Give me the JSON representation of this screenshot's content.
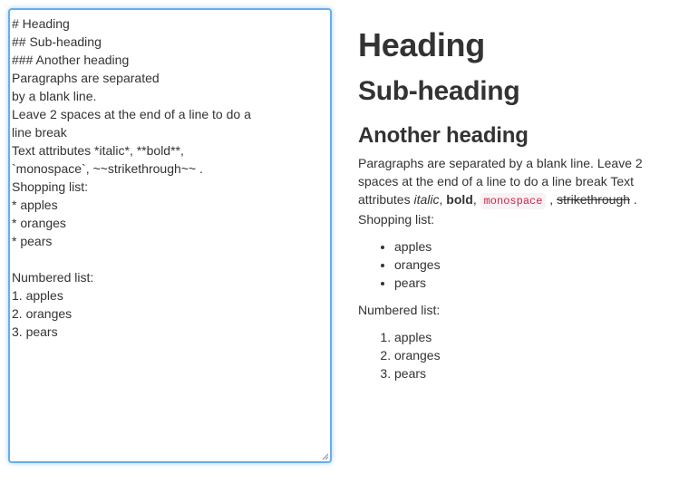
{
  "editor": {
    "text": "# Heading\n## Sub-heading\n### Another heading\nParagraphs are separated\nby a blank line.\nLeave 2 spaces at the end of a line to do a\nline break\nText attributes *italic*, **bold**,\n`monospace`, ~~strikethrough~~ .\nShopping list:\n* apples\n* oranges\n* pears\n\nNumbered list:\n1. apples\n2. oranges\n3. pears"
  },
  "preview": {
    "h1": "Heading",
    "h2": "Sub-heading",
    "h3": "Another heading",
    "paragraph": {
      "text_start": "Paragraphs are separated by a blank line. Leave 2 spaces at the end of a line to do a line break Text attributes ",
      "italic": "italic",
      "comma1": ", ",
      "bold": "bold",
      "comma2": ", ",
      "monospace": "monospace",
      "comma3": " , ",
      "strikethrough": "strikethrough",
      "period": " .",
      "shopping_label": "Shopping list:"
    },
    "shopping_list": [
      "apples",
      "oranges",
      "pears"
    ],
    "numbered_label": "Numbered list:",
    "numbered_list": [
      "apples",
      "oranges",
      "pears"
    ]
  },
  "colors": {
    "focus_border": "#66afe9",
    "code_text": "#c7254e",
    "code_bg": "#f9f2f4",
    "text": "#333333"
  }
}
